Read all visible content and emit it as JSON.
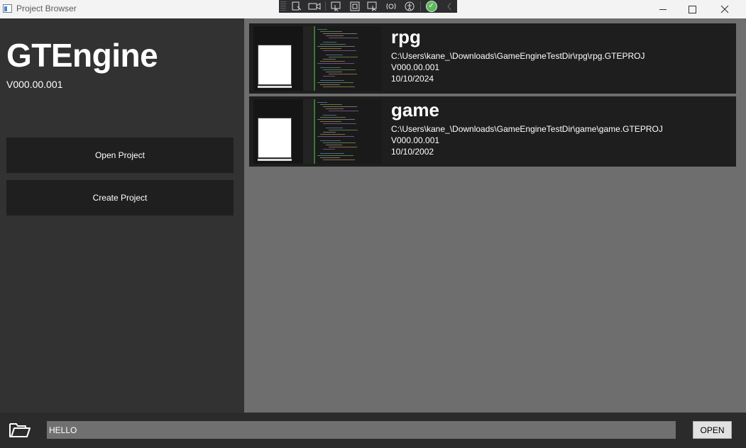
{
  "window": {
    "title": "Project Browser"
  },
  "debug_toolbar": {
    "tools": [
      "select-element-icon",
      "record-icon",
      "pointer-select-icon",
      "adorner-icon",
      "track-focus-icon",
      "hot-reload-icon",
      "accessibility-icon",
      "binding-check-icon",
      "collapse-icon"
    ]
  },
  "sidebar": {
    "engine_name": "GTEngine",
    "engine_version": "V000.00.001",
    "open_project_label": "Open Project",
    "create_project_label": "Create Project"
  },
  "projects": [
    {
      "name": "rpg",
      "path": "C:\\Users\\kane_\\Downloads\\GameEngineTestDir\\rpg\\rpg.GTEPROJ",
      "version": "V000.00.001",
      "date": "10/10/2024"
    },
    {
      "name": "game",
      "path": "C:\\Users\\kane_\\Downloads\\GameEngineTestDir\\game\\game.GTEPROJ",
      "version": "V000.00.001",
      "date": "10/10/2002"
    }
  ],
  "bottom_bar": {
    "path_value": "HELLO",
    "open_label": "OPEN"
  },
  "colors": {
    "sidebar_bg": "#323232",
    "list_bg": "#6e6e6e",
    "card_bg": "#1e1e1e",
    "button_bg": "#1f1f1f",
    "input_bg": "#707070"
  }
}
